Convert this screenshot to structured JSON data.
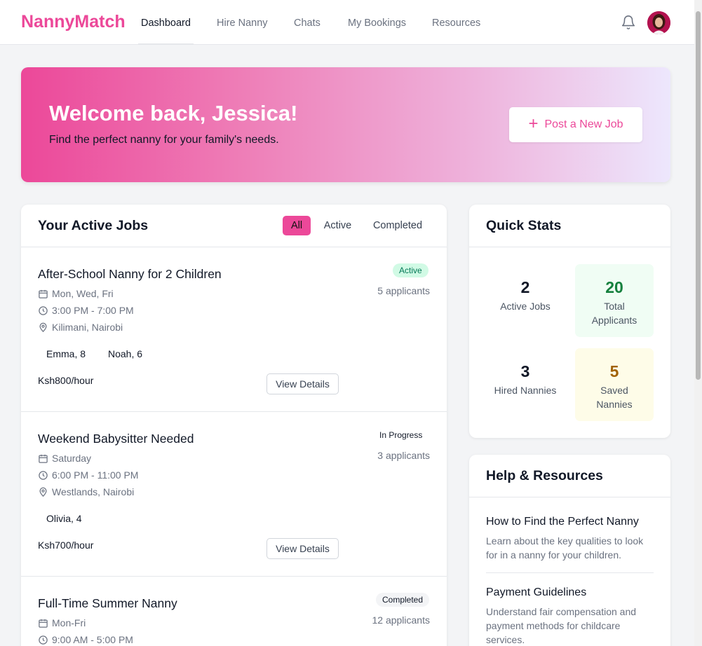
{
  "header": {
    "brand": "NannyMatch",
    "nav": [
      "Dashboard",
      "Hire Nanny",
      "Chats",
      "My Bookings",
      "Resources"
    ],
    "active_nav": "Dashboard",
    "icons": {
      "notifications": "bell-icon",
      "profile": "avatar"
    }
  },
  "hero": {
    "title": "Welcome back, Jessica!",
    "subtitle": "Find the perfect nanny for your family's needs.",
    "post_button": "Post a New Job"
  },
  "jobs": {
    "title": "Your Active Jobs",
    "filters": [
      "All",
      "Active",
      "Completed"
    ],
    "active_filter": "All",
    "items": [
      {
        "title": "After-School Nanny for 2 Children",
        "days": "Mon, Wed, Fri",
        "time": "3:00 PM - 7:00 PM",
        "location": "Kilimani, Nairobi",
        "children": [
          "Emma, 8",
          "Noah, 6"
        ],
        "rate": "Ksh800/hour",
        "status": "Active",
        "applicants": "5 applicants",
        "button": "View Details"
      },
      {
        "title": "Weekend Babysitter Needed",
        "days": "Saturday",
        "time": "6:00 PM - 11:00 PM",
        "location": "Westlands, Nairobi",
        "children": [
          "Olivia, 4"
        ],
        "rate": "Ksh700/hour",
        "status": "In Progress",
        "applicants": "3 applicants",
        "button": "View Details"
      },
      {
        "title": "Full-Time Summer Nanny",
        "days": "Mon-Fri",
        "time": "9:00 AM - 5:00 PM",
        "status": "Completed",
        "applicants": "12 applicants"
      }
    ]
  },
  "stats": {
    "title": "Quick Stats",
    "items": [
      {
        "value": "2",
        "label": "Active Jobs",
        "color": "#111827",
        "bg": "#ffffff"
      },
      {
        "value": "20",
        "label": "Total Applicants",
        "color": "#15803d",
        "bg": "#f0fdf4"
      },
      {
        "value": "3",
        "label": "Hired Nannies",
        "color": "#111827",
        "bg": "#ffffff"
      },
      {
        "value": "5",
        "label": "Saved Nannies",
        "color": "#a16207",
        "bg": "#fefce8"
      }
    ]
  },
  "help": {
    "title": "Help & Resources",
    "items": [
      {
        "title": "How to Find the Perfect Nanny",
        "desc": "Learn about the key qualities to look for in a nanny for your children."
      },
      {
        "title": "Payment Guidelines",
        "desc": "Understand fair compensation and payment methods for childcare services."
      }
    ]
  },
  "colors": {
    "brand": "#ec4899",
    "active_badge_bg": "#d1fae5",
    "active_badge_text": "#047857"
  }
}
